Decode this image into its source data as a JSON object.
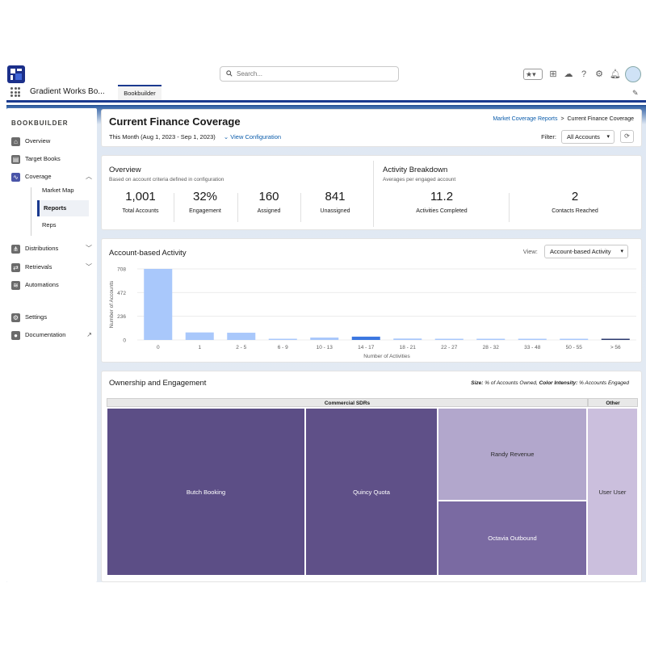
{
  "header": {
    "search_placeholder": "Search...",
    "app_name": "Gradient Works Bo...",
    "tab": "Bookbuilder"
  },
  "sidebar": {
    "title": "BOOKBUILDER",
    "items": [
      {
        "label": "Overview",
        "icon": "home-icon"
      },
      {
        "label": "Target Books",
        "icon": "book-icon"
      },
      {
        "label": "Coverage",
        "icon": "pulse-icon"
      },
      {
        "label": "Distributions",
        "icon": "share-icon"
      },
      {
        "label": "Retrievals",
        "icon": "retrieve-icon"
      },
      {
        "label": "Automations",
        "icon": "automation-icon"
      },
      {
        "label": "Settings",
        "icon": "gear-icon"
      },
      {
        "label": "Documentation",
        "icon": "bulb-icon"
      }
    ],
    "coverage_sub": [
      "Market Map",
      "Reports",
      "Reps"
    ],
    "active_sub": "Reports"
  },
  "page": {
    "title": "Current Finance Coverage",
    "date_range": "This Month (Aug 1, 2023 - Sep 1, 2023)",
    "view_config": "View Configuration",
    "breadcrumb_link": "Market Coverage Reports",
    "breadcrumb_sep": ">",
    "breadcrumb_current": "Current Finance Coverage",
    "filter_label": "Filter:",
    "filter_value": "All Accounts"
  },
  "overview": {
    "title": "Overview",
    "subtitle": "Based on account criteria defined in configuration",
    "stats": [
      {
        "value": "1,001",
        "label": "Total Accounts"
      },
      {
        "value": "32%",
        "label": "Engagement"
      },
      {
        "value": "160",
        "label": "Assigned"
      },
      {
        "value": "841",
        "label": "Unassigned"
      }
    ]
  },
  "activity_breakdown": {
    "title": "Activity Breakdown",
    "subtitle": "Averages per engaged account",
    "stats": [
      {
        "value": "11.2",
        "label": "Activities Completed"
      },
      {
        "value": "2",
        "label": "Contacts Reached"
      }
    ]
  },
  "account_activity": {
    "title": "Account-based Activity",
    "view_label": "View:",
    "view_value": "Account-based Activity"
  },
  "chart_data": {
    "type": "bar",
    "categories": [
      "0",
      "1",
      "2 - 5",
      "6 - 9",
      "10 - 13",
      "14 - 17",
      "18 - 21",
      "22 - 27",
      "28 - 32",
      "33 - 48",
      "50 - 55",
      "> 56"
    ],
    "values": [
      708,
      75,
      72,
      6,
      24,
      33,
      14,
      8,
      5,
      4,
      5,
      12
    ],
    "highlight": [
      false,
      false,
      false,
      false,
      false,
      true,
      false,
      false,
      false,
      false,
      false,
      true
    ],
    "xlabel": "Number of Activities",
    "ylabel": "Number of Accounts",
    "yticks": [
      "708",
      "472",
      "236",
      "0"
    ],
    "ylim": [
      0,
      708
    ],
    "colors": {
      "bar": "#a9c8fb",
      "highlight": "#3b77e0",
      "dark": "#2b3a6e"
    }
  },
  "ownership": {
    "title": "Ownership and Engagement",
    "legend_size_label": "Size:",
    "legend_size_text": "% of Accounts Owned,",
    "legend_color_label": "Color Intensity:",
    "legend_color_text": "% Accounts Engaged",
    "groups": [
      "Commercial SDRs",
      "Other"
    ],
    "cells": [
      {
        "name": "Butch Booking",
        "color": "#5c4e86",
        "text_color": "#ffffff"
      },
      {
        "name": "Quincy Quota",
        "color": "#5f5088",
        "text_color": "#ffffff"
      },
      {
        "name": "Randy Revenue",
        "color": "#b2a7cc",
        "text_color": "#2b2b2b"
      },
      {
        "name": "Octavia Outbound",
        "color": "#7a6aa2",
        "text_color": "#ffffff"
      },
      {
        "name": "User User",
        "color": "#cbbfdd",
        "text_color": "#2b2b2b"
      }
    ]
  }
}
